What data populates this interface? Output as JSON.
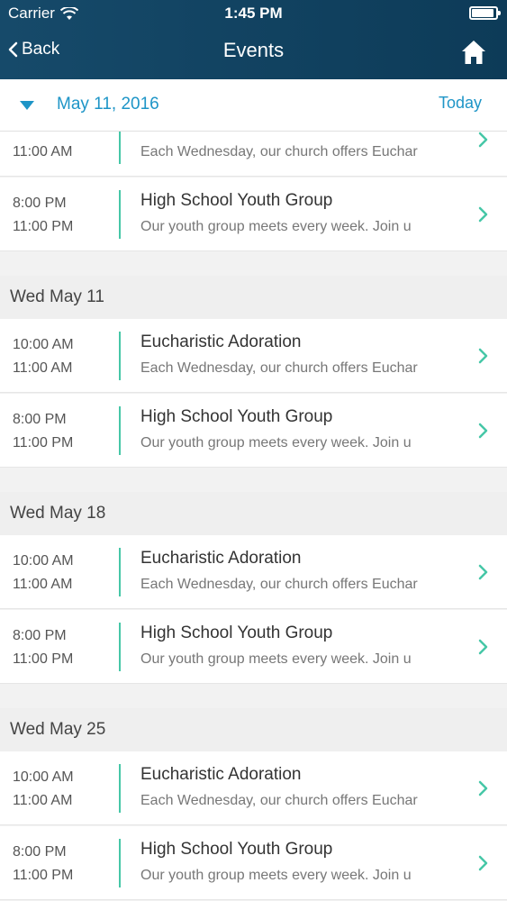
{
  "status": {
    "carrier": "Carrier",
    "time": "1:45 PM"
  },
  "nav": {
    "back_label": "Back",
    "title": "Events"
  },
  "date_bar": {
    "date": "May 11, 2016",
    "today_label": "Today"
  },
  "partial_rows": [
    {
      "end": "11:00 AM",
      "desc": "Each Wednesday, our church offers Euchar"
    },
    {
      "start": "8:00 PM",
      "end": "11:00 PM",
      "title": "High School Youth Group",
      "desc": "Our youth group meets every week. Join u"
    }
  ],
  "sections": [
    {
      "header": "Wed May 11",
      "events": [
        {
          "start": "10:00 AM",
          "end": "11:00 AM",
          "title": "Eucharistic Adoration",
          "desc": "Each Wednesday, our church offers Euchar"
        },
        {
          "start": "8:00 PM",
          "end": "11:00 PM",
          "title": "High School Youth Group",
          "desc": "Our youth group meets every week. Join u"
        }
      ]
    },
    {
      "header": "Wed May 18",
      "events": [
        {
          "start": "10:00 AM",
          "end": "11:00 AM",
          "title": "Eucharistic Adoration",
          "desc": "Each Wednesday, our church offers Euchar"
        },
        {
          "start": "8:00 PM",
          "end": "11:00 PM",
          "title": "High School Youth Group",
          "desc": "Our youth group meets every week. Join u"
        }
      ]
    },
    {
      "header": "Wed May 25",
      "events": [
        {
          "start": "10:00 AM",
          "end": "11:00 AM",
          "title": "Eucharistic Adoration",
          "desc": "Each Wednesday, our church offers Euchar"
        },
        {
          "start": "8:00 PM",
          "end": "11:00 PM",
          "title": "High School Youth Group",
          "desc": "Our youth group meets every week. Join u"
        }
      ]
    }
  ],
  "colors": {
    "header": "#164a6a",
    "accent": "#1e95c7",
    "divider": "#46c7a7"
  },
  "icons": {
    "back": "chevron-left-icon",
    "home": "home-icon",
    "caret": "caret-down-icon",
    "row": "chevron-right-icon",
    "wifi": "wifi-icon",
    "battery": "battery-icon"
  }
}
